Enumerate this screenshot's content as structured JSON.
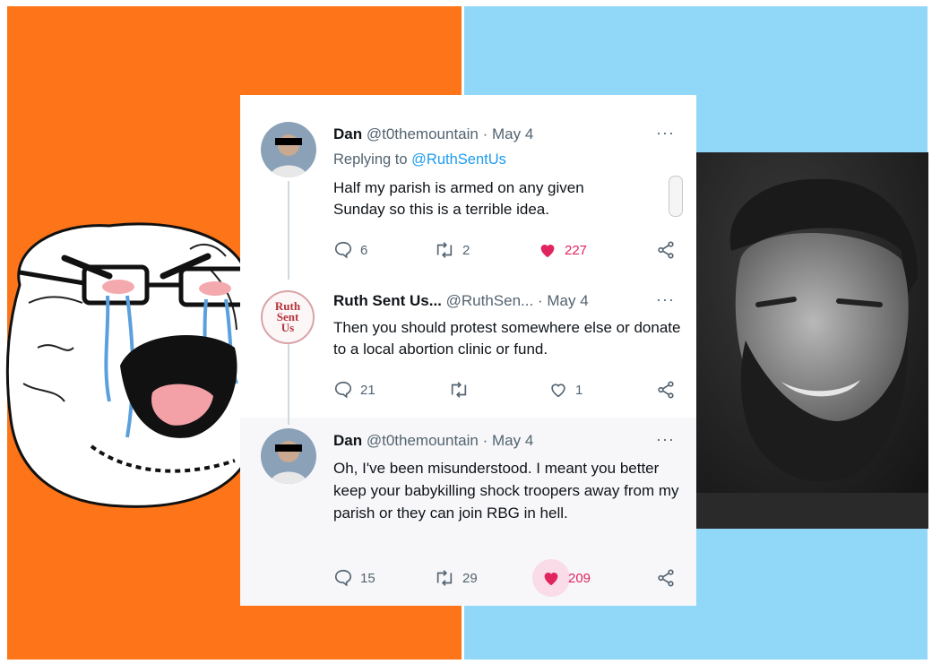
{
  "colors": {
    "left_bg": "#fe7419",
    "right_bg": "#91d7f7",
    "text": "#0f1419",
    "muted": "#536471",
    "link": "#1d9bf0",
    "like": "#e0245e"
  },
  "images": {
    "left": "crying-wojak-drawing",
    "right": "grayscale-bearded-man-photo"
  },
  "tweets": [
    {
      "name": "Dan",
      "handle": "@t0themountain",
      "date": "May 4",
      "reply_prefix": "Replying to",
      "reply_to": "@RuthSentUs",
      "text": "Half my parish is armed on any given Sunday so this is a terrible idea.",
      "replies": "6",
      "retweets": "2",
      "likes": "227",
      "liked": true
    },
    {
      "name": "Ruth Sent Us...",
      "handle": "@RuthSen...",
      "date": "May 4",
      "avatar_text": "Ruth Sent Us",
      "text": "Then you should protest somewhere else or donate to a local abortion clinic or fund.",
      "replies": "21",
      "retweets": "",
      "likes": "1",
      "liked": false
    },
    {
      "name": "Dan",
      "handle": "@t0themountain",
      "date": "May 4",
      "text": "Oh, I've been misunderstood. I meant you better keep your babykilling shock troopers away from my parish or they can join RBG in hell.",
      "replies": "15",
      "retweets": "29",
      "likes": "209",
      "liked": true
    }
  ]
}
